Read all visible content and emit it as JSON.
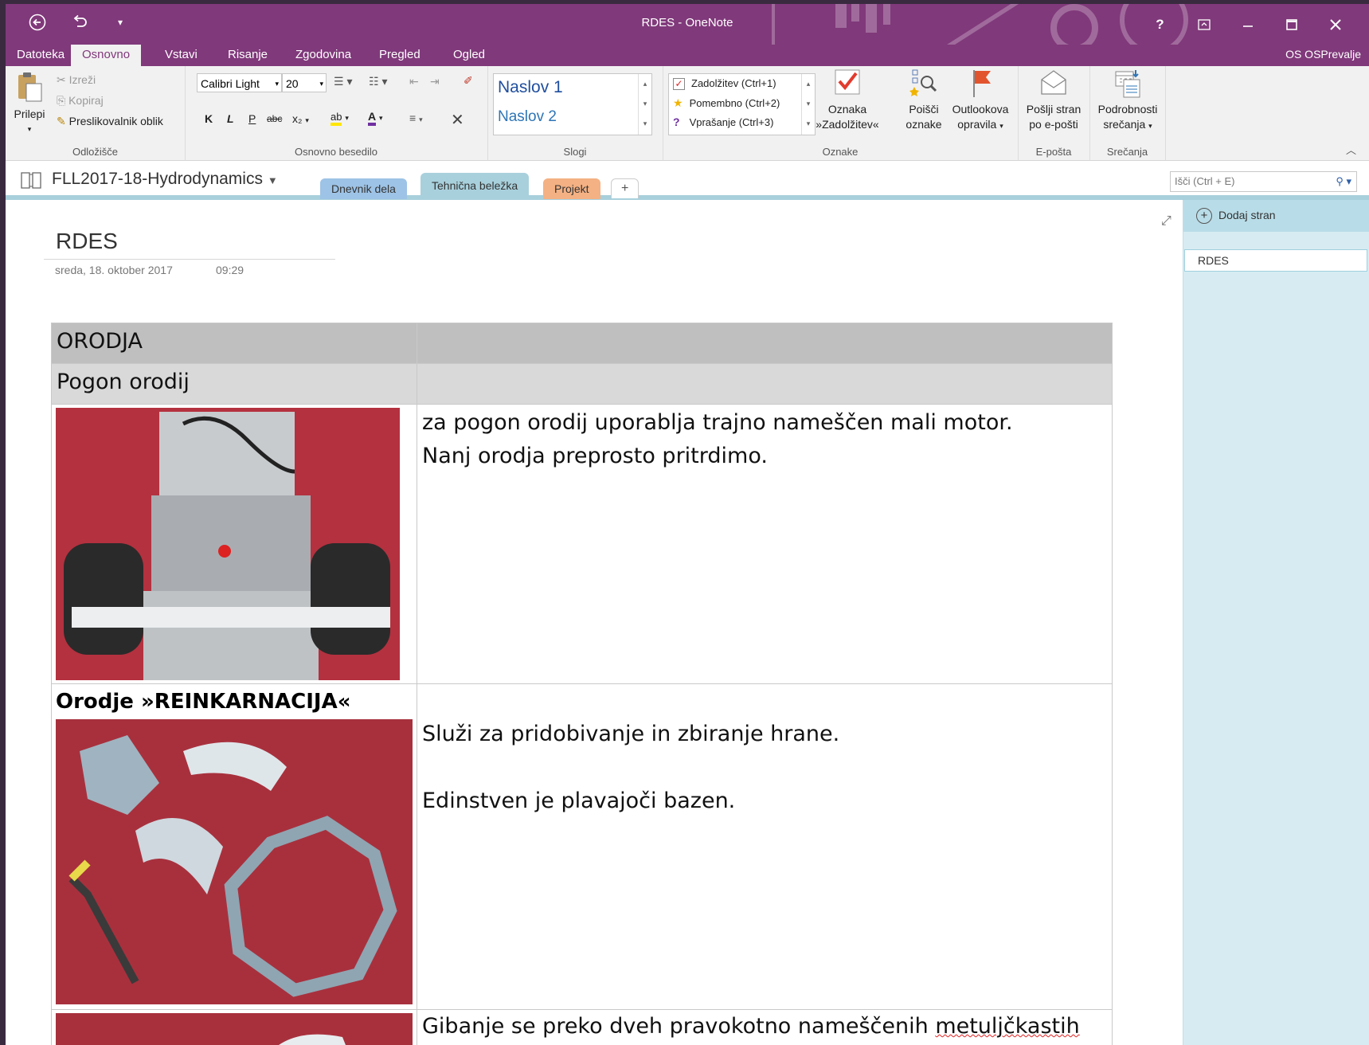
{
  "window": {
    "title": "RDES - OneNote",
    "user": "OS OSPrevalje"
  },
  "ribbon_tabs": [
    "Datoteka",
    "Osnovno",
    "Vstavi",
    "Risanje",
    "Zgodovina",
    "Pregled",
    "Ogled"
  ],
  "clipboard": {
    "paste": "Prilepi",
    "cut": "Izreži",
    "copy": "Kopiraj",
    "format_painter": "Preslikovalnik oblik",
    "label": "Odložišče"
  },
  "basic_text": {
    "font": "Calibri Light",
    "size": "20",
    "bold": "K",
    "italic": "L",
    "underline": "P",
    "strike": "abc",
    "sub": "x₂",
    "label": "Osnovno besedilo"
  },
  "styles": {
    "h1": "Naslov 1",
    "h2": "Naslov 2",
    "label": "Slogi"
  },
  "tags": {
    "items": [
      "Zadolžitev (Ctrl+1)",
      "Pomembno (Ctrl+2)",
      "Vprašanje (Ctrl+3)"
    ],
    "todo_tag": [
      "Oznaka",
      "»Zadolžitev«"
    ],
    "find_tags": [
      "Poišči",
      "oznake"
    ],
    "outlook": [
      "Outlookova",
      "opravila"
    ],
    "label": "Oznake"
  },
  "email": {
    "btn": [
      "Pošlji stran",
      "po e-pošti"
    ],
    "label": "E-pošta"
  },
  "meetings": {
    "btn": [
      "Podrobnosti",
      "srečanja"
    ],
    "label": "Srečanja"
  },
  "notebook": {
    "name": "FLL2017-18-Hydrodynamics",
    "sections": [
      "Dnevnik dela",
      "Tehnična beležka",
      "Projekt"
    ],
    "add": "+",
    "search_placeholder": "Išči (Ctrl + E)"
  },
  "page": {
    "title": "RDES",
    "date": "sreda, 18. oktober 2017",
    "time": "09:29",
    "table": {
      "h1": "ORODJA",
      "h2": "Pogon orodij",
      "row1_text": [
        "za pogon orodij uporablja trajno nameščen mali motor.",
        "Nanj orodja preprosto pritrdimo."
      ],
      "row2_title": "Orodje »REINKARNACIJA«",
      "row2_text": [
        "Služi za pridobivanje in zbiranje hrane.",
        "Edinstven je plavajoči bazen."
      ],
      "row3_text_a": "Gibanje se preko dveh pravokotno nameščenih ",
      "row3_text_b": "metuljčkastih"
    }
  },
  "pagelist": {
    "add": "Dodaj stran",
    "pages": [
      "RDES"
    ]
  },
  "colors": {
    "accent": "#80397b",
    "page_list": "#d6ecf2",
    "photo_bg": "#b4313f"
  }
}
